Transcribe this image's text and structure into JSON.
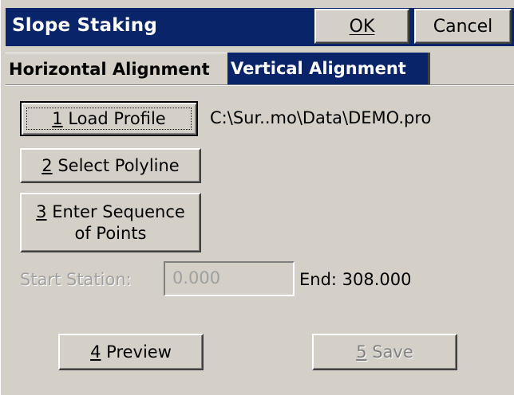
{
  "window": {
    "title": "Slope Staking",
    "ok_label": "OK",
    "cancel_label": "Cancel"
  },
  "tabs": [
    {
      "label": "Horizontal Alignment",
      "selected": false
    },
    {
      "label": "Vertical Alignment",
      "selected": true
    }
  ],
  "buttons": {
    "load_profile": {
      "mnemonic": "1",
      "label": " Load Profile"
    },
    "select_polyline": {
      "mnemonic": "2",
      "label": " Select Polyline"
    },
    "enter_sequence": {
      "mnemonic": "3",
      "label_line1": " Enter Sequence",
      "label_line2": "of Points"
    },
    "preview": {
      "mnemonic": "4",
      "label": " Preview"
    },
    "save": {
      "mnemonic": "5",
      "label": " Save",
      "enabled": false
    }
  },
  "profile_path": "C:\\Sur..mo\\Data\\DEMO.pro",
  "start_station": {
    "label": "Start Station:",
    "value": "0.000",
    "enabled": false
  },
  "end_station": "End: 308.000",
  "colors": {
    "title_bar": "#0a246a",
    "face": "#d4d0c8",
    "disabled_text": "#a0a0a0"
  }
}
